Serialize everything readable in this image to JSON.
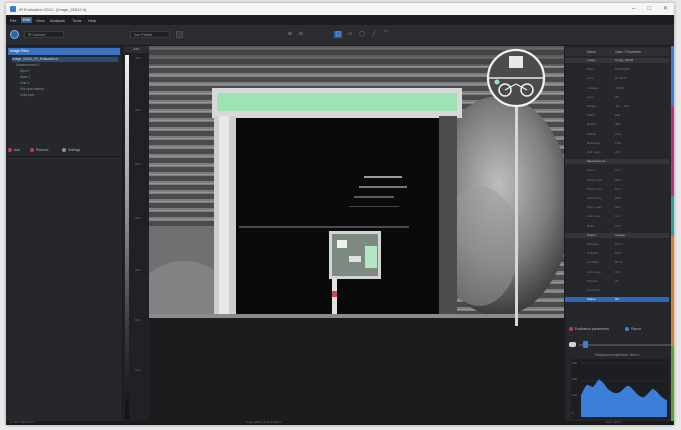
{
  "window": {
    "title": "IR Evaluation 2024 - [image_00042.ir]",
    "controls": [
      "–",
      "□",
      "✕"
    ]
  },
  "menu": [
    "File",
    "Edit",
    "View",
    "Analysis",
    "Tools",
    "Help"
  ],
  "toolbar": {
    "combo1": "IR Camera",
    "combo2": "Iron Palette",
    "zoom_in": "⊕",
    "zoom_out": "⊖",
    "tools": [
      "⬚",
      "▭",
      "◯",
      "╱",
      "⌒"
    ]
  },
  "left_panel": {
    "header": "Image Files",
    "tree": [
      "image_00042_IR_Evaluation.ir",
      "Measurement 1",
      "Spot 1",
      "Area 1",
      "Line 1",
      "Hot spot marker",
      "Cold spot"
    ],
    "buttons": {
      "add": "Add",
      "remove": "Remove",
      "settings": "Settings"
    }
  },
  "ruler": {
    "top": "Auto",
    "ticks": [
      "40.0",
      "35.0",
      "30.0",
      "25.0",
      "20.0",
      "15.0",
      "10.0"
    ]
  },
  "right_panel": {
    "columns": [
      "",
      "Name",
      "Value / Parameter"
    ],
    "rows": [
      {
        "c1": "",
        "c2": "Image",
        "c3": "image_00042",
        "type": "section"
      },
      {
        "c1": "",
        "c2": "Date",
        "c3": "12/03/2024"
      },
      {
        "c1": "",
        "c2": "Time",
        "c3": "10:42:17"
      },
      {
        "c1": "",
        "c2": "Camera",
        "c3": "IR-640"
      },
      {
        "c1": "",
        "c2": "Lens",
        "c3": "25°"
      },
      {
        "c1": "",
        "c2": "Range",
        "c3": "-20 ... 120"
      },
      {
        "c1": "",
        "c2": "Width",
        "c3": "640"
      },
      {
        "c1": "",
        "c2": "Height",
        "c3": "480"
      },
      {
        "c1": "",
        "c2": "Palette",
        "c3": "Grey"
      },
      {
        "c1": "",
        "c2": "Emissivity",
        "c3": "0.95"
      },
      {
        "c1": "",
        "c2": "Refl. temp.",
        "c3": "20.0"
      },
      {
        "c1": "",
        "c2": "Measurement",
        "c3": "",
        "type": "section"
      },
      {
        "c1": "",
        "c2": "Spot 1",
        "c3": "21.4"
      },
      {
        "c1": "",
        "c2": "Area 1 max",
        "c3": "36.8"
      },
      {
        "c1": "",
        "c2": "Area 1 min",
        "c3": "12.1"
      },
      {
        "c1": "",
        "c2": "Area 1 avg",
        "c3": "18.9"
      },
      {
        "c1": "",
        "c2": "Line 1 max",
        "c3": "33.2"
      },
      {
        "c1": "",
        "c2": "Line 1 min",
        "c3": "11.7"
      },
      {
        "c1": "",
        "c2": "Delta",
        "c3": "21.5"
      },
      {
        "c1": "",
        "c2": "Object",
        "c3": "Garage",
        "type": "section"
      },
      {
        "c1": "",
        "c2": "Distance",
        "c3": "5.0 m"
      },
      {
        "c1": "",
        "c2": "Ambient",
        "c3": "19.0"
      },
      {
        "c1": "",
        "c2": "Humidity",
        "c3": "50 %"
      },
      {
        "c1": "",
        "c2": "Atm. temp.",
        "c3": "19.0"
      },
      {
        "c1": "",
        "c2": "Window",
        "c3": "off"
      },
      {
        "c1": "",
        "c2": "Comment",
        "c3": ""
      },
      {
        "c1": "",
        "c2": "Status",
        "c3": "OK",
        "type": "sel"
      }
    ],
    "buttons": {
      "evaluation": "Evaluation parameters",
      "report": "Report"
    },
    "histogram_title": "Histogram temperature / Area 1",
    "histogram_ticks": [
      "300",
      "200",
      "100",
      "0"
    ],
    "histogram_values": [
      40,
      52,
      60,
      58,
      55,
      62,
      70,
      66,
      60,
      52,
      48,
      45,
      44,
      46,
      50,
      56,
      58,
      54,
      48,
      42,
      38,
      36,
      40,
      46,
      52,
      50,
      44,
      38,
      34,
      30
    ],
    "colors": {
      "accent_blue": "#3b7fd9",
      "accent_magenta": "#c0307c",
      "accent_teal": "#2f9e9a",
      "accent_orange": "#d9822b",
      "accent_green": "#5aa33a"
    }
  },
  "status": {
    "left": "X: 312  Y: 206  21.4 °C",
    "mid": "image_00042_IR_Evaluation.ir",
    "right": "Zoom 100 %"
  }
}
